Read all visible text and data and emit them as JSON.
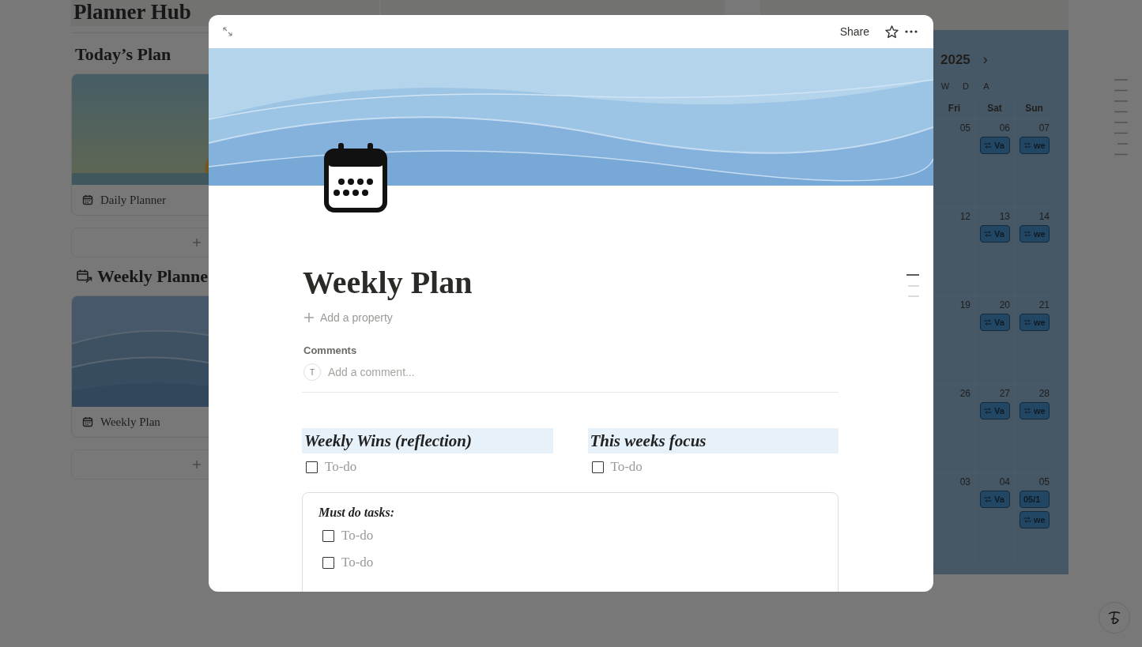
{
  "background_page": {
    "left_column": {
      "title": "Planner Hub",
      "sections": [
        {
          "heading": "Today’s Plan",
          "heading_icon": false,
          "card": {
            "title": "Daily Planner",
            "kind": "sunrise"
          }
        },
        {
          "heading": "Weekly Planne",
          "heading_icon": true,
          "card": {
            "title": "Weekly Plan",
            "kind": "waves"
          }
        }
      ]
    },
    "right_column": {
      "year": "2025",
      "next": "›",
      "views": [
        "W",
        "D",
        "A"
      ],
      "days": [
        "Fri",
        "Sat",
        "Sun"
      ],
      "weeks": [
        [
          {
            "date": "05"
          },
          {
            "date": "06",
            "events": [
              {
                "label": "Va",
                "repeat": true
              }
            ]
          },
          {
            "date": "07",
            "events": [
              {
                "label": "we",
                "repeat": true
              }
            ]
          }
        ],
        [
          {
            "date": "12"
          },
          {
            "date": "13",
            "events": [
              {
                "label": "Va",
                "repeat": true
              }
            ]
          },
          {
            "date": "14",
            "events": [
              {
                "label": "we",
                "repeat": true
              }
            ]
          }
        ],
        [
          {
            "date": "19"
          },
          {
            "date": "20",
            "events": [
              {
                "label": "Va",
                "repeat": true
              }
            ]
          },
          {
            "date": "21",
            "events": [
              {
                "label": "we",
                "repeat": true
              }
            ]
          }
        ],
        [
          {
            "date": "26"
          },
          {
            "date": "27",
            "events": [
              {
                "label": "Va",
                "repeat": true
              }
            ]
          },
          {
            "date": "28",
            "events": [
              {
                "label": "we",
                "repeat": true
              }
            ]
          }
        ],
        [
          {
            "date": "03"
          },
          {
            "date": "04",
            "events": [
              {
                "label": "Va",
                "repeat": true
              }
            ]
          },
          {
            "date": "05",
            "events": [
              {
                "label": "05/1",
                "repeat": false
              },
              {
                "label": "we",
                "repeat": true
              }
            ]
          }
        ]
      ]
    }
  },
  "modal": {
    "share": "Share",
    "title": "Weekly Plan",
    "add_property": "Add a property",
    "comments_label": "Comments",
    "comment_avatar": "T",
    "comment_placeholder": "Add a comment...",
    "columns": [
      {
        "heading": "Weekly Wins (reflection)",
        "todos": [
          {
            "text": "To-do",
            "checked": false
          }
        ]
      },
      {
        "heading": "This weeks focus",
        "todos": [
          {
            "text": "To-do",
            "checked": false
          }
        ]
      }
    ],
    "callout": {
      "heading": "Must do tasks:",
      "todos": [
        {
          "text": "To-do",
          "checked": false
        },
        {
          "text": "To-do",
          "checked": false
        }
      ]
    }
  }
}
